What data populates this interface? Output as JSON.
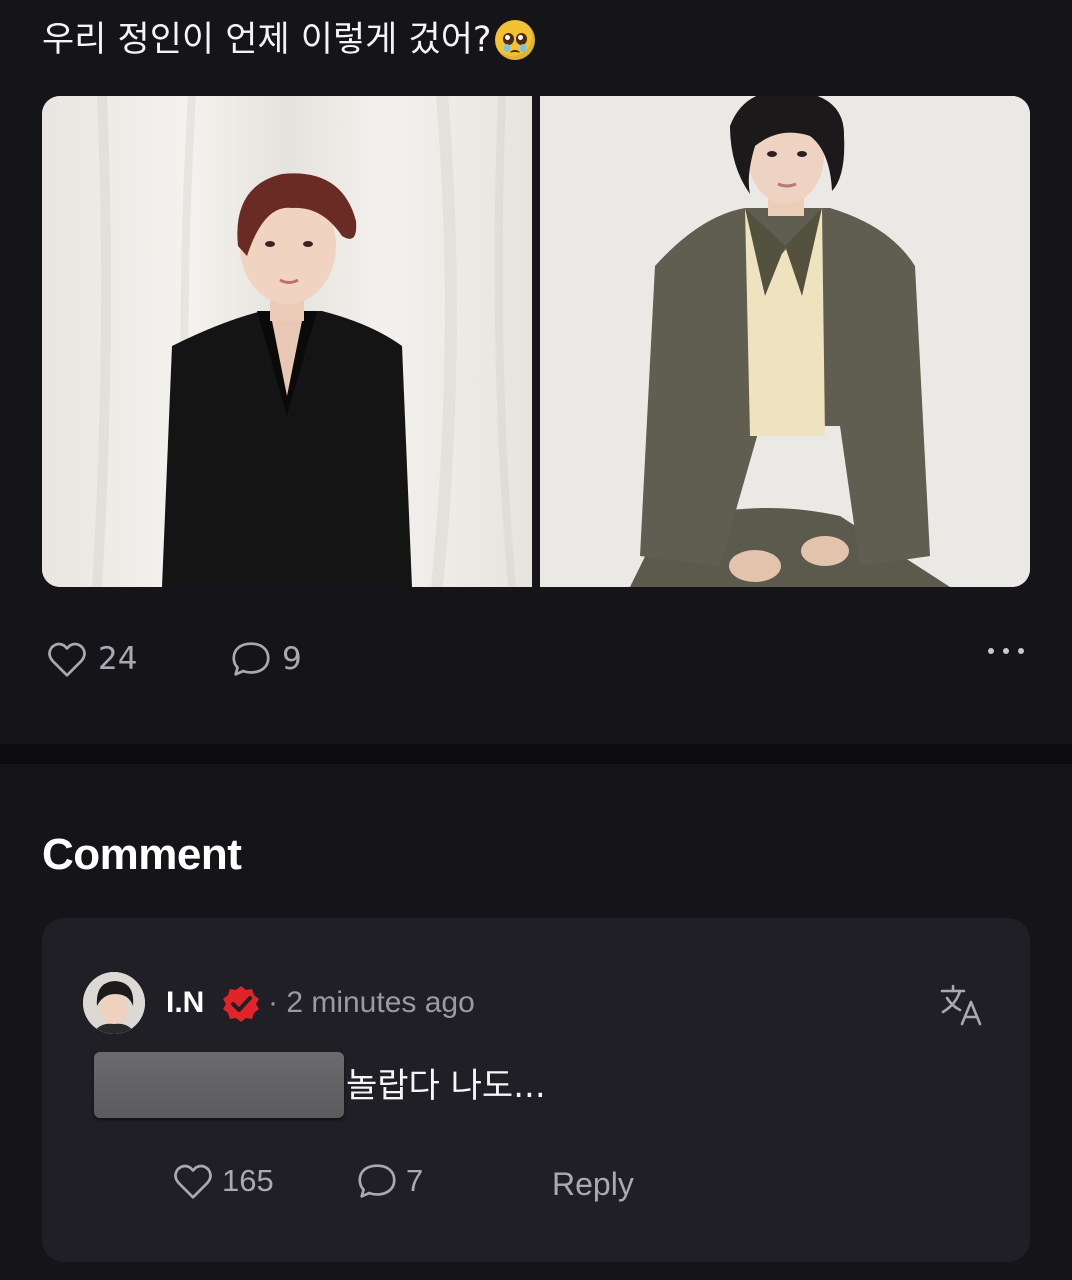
{
  "post": {
    "text": "우리 정인이 언제 이렇게 겄어?",
    "emoji": "pleading-face-emoji",
    "photos": [
      "photo-left",
      "photo-right"
    ],
    "likes": "24",
    "comments": "9"
  },
  "comments_section": {
    "title": "Comment",
    "items": [
      {
        "username": "I.N",
        "verified": true,
        "timestamp": "· 2 minutes ago",
        "body": "놀랍다 나도...",
        "likes": "165",
        "replies": "7",
        "reply_label": "Reply"
      }
    ]
  },
  "colors": {
    "background": "#151519",
    "card": "#1f1f25",
    "divider": "#0c0c0e",
    "muted_text": "#a9a9b0",
    "badge_red": "#e0242a"
  }
}
